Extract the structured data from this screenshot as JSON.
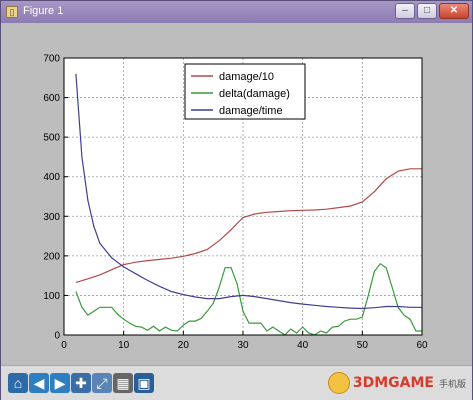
{
  "window": {
    "title": "Figure 1",
    "buttons": {
      "minimize": "–",
      "maximize": "□",
      "close": "✕"
    }
  },
  "toolbar": {
    "tools": [
      {
        "name": "home-icon",
        "glyph": "⌂",
        "color": "#2f6aa8"
      },
      {
        "name": "back-icon",
        "glyph": "◀",
        "color": "#2e7fc1"
      },
      {
        "name": "forward-icon",
        "glyph": "▶",
        "color": "#2e7fc1"
      },
      {
        "name": "pan-icon",
        "glyph": "✚",
        "color": "#3b6ea5"
      },
      {
        "name": "zoom-icon",
        "glyph": "⤢",
        "color": "#5a84b6"
      },
      {
        "name": "configure-subplots-icon",
        "glyph": "▦",
        "color": "#666666"
      },
      {
        "name": "save-icon",
        "glyph": "▣",
        "color": "#2b5d97"
      }
    ],
    "watermark": {
      "text": "3DMGAME",
      "sub": "手机版"
    }
  },
  "chart_data": {
    "type": "line",
    "title": "",
    "xlabel": "",
    "ylabel": "",
    "xlim": [
      0,
      60
    ],
    "ylim": [
      0,
      700
    ],
    "xticks": [
      0,
      10,
      20,
      30,
      40,
      50,
      60
    ],
    "yticks": [
      0,
      100,
      200,
      300,
      400,
      500,
      600,
      700
    ],
    "grid": true,
    "legend_position": "upper-center",
    "series": [
      {
        "name": "damage/10",
        "color": "#b24a4a",
        "x": [
          2,
          4,
          6,
          8,
          10,
          12,
          14,
          16,
          18,
          20,
          22,
          24,
          26,
          28,
          30,
          32,
          34,
          36,
          38,
          40,
          42,
          44,
          46,
          48,
          50,
          52,
          54,
          56,
          58,
          60
        ],
        "y": [
          133,
          142,
          152,
          165,
          178,
          184,
          188,
          191,
          194,
          199,
          206,
          216,
          238,
          266,
          297,
          306,
          310,
          312,
          314,
          315,
          316,
          318,
          322,
          326,
          336,
          362,
          395,
          414,
          420,
          420
        ]
      },
      {
        "name": "delta(damage)",
        "color": "#3a9a3a",
        "x": [
          2,
          3,
          4,
          5,
          6,
          7,
          8,
          9,
          10,
          11,
          12,
          13,
          14,
          15,
          16,
          17,
          18,
          19,
          20,
          21,
          22,
          23,
          24,
          25,
          26,
          27,
          28,
          29,
          30,
          31,
          32,
          33,
          34,
          35,
          36,
          37,
          38,
          39,
          40,
          41,
          42,
          43,
          44,
          45,
          46,
          47,
          48,
          49,
          50,
          51,
          52,
          53,
          54,
          55,
          56,
          57,
          58,
          59,
          60
        ],
        "y": [
          110,
          70,
          50,
          60,
          70,
          70,
          70,
          52,
          40,
          30,
          22,
          20,
          12,
          22,
          10,
          20,
          12,
          10,
          25,
          35,
          35,
          42,
          60,
          80,
          120,
          170,
          170,
          130,
          60,
          30,
          30,
          30,
          10,
          20,
          10,
          0,
          15,
          5,
          20,
          5,
          0,
          10,
          5,
          20,
          22,
          35,
          40,
          40,
          45,
          100,
          160,
          180,
          170,
          120,
          70,
          50,
          40,
          10,
          10
        ]
      },
      {
        "name": "damage/time",
        "color": "#3f3f8f",
        "x": [
          2,
          3,
          4,
          5,
          6,
          8,
          10,
          12,
          14,
          16,
          18,
          20,
          22,
          24,
          26,
          28,
          30,
          32,
          34,
          36,
          38,
          40,
          42,
          44,
          46,
          48,
          50,
          52,
          54,
          56,
          58,
          60
        ],
        "y": [
          660,
          450,
          340,
          275,
          232,
          195,
          172,
          155,
          138,
          123,
          110,
          102,
          96,
          92,
          92,
          97,
          100,
          97,
          92,
          87,
          82,
          78,
          75,
          72,
          70,
          68,
          67,
          69,
          72,
          72,
          70,
          70
        ]
      }
    ]
  }
}
